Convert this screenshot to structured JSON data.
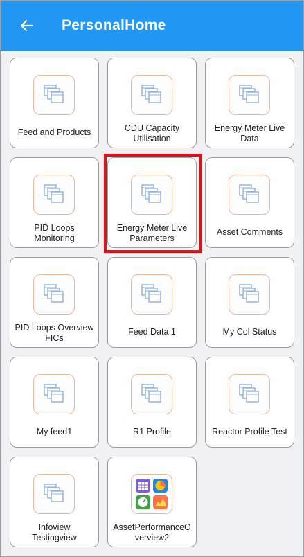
{
  "header": {
    "title": "PersonalHome",
    "back_icon": "arrow-left-icon"
  },
  "colors": {
    "appbar": "#2196f3",
    "highlight": "#e0101a",
    "icon_border": "#f2b89a"
  },
  "tiles": [
    {
      "label": "Feed and Products",
      "icon": "stacked-windows-icon"
    },
    {
      "label": "CDU Capacity\nUtilisation",
      "icon": "stacked-windows-icon"
    },
    {
      "label": "Energy Meter Live\nData",
      "icon": "stacked-windows-icon"
    },
    {
      "label": "PID Loops\nMonitoring",
      "icon": "stacked-windows-icon"
    },
    {
      "label": "Energy Meter Live\nParameters",
      "icon": "stacked-windows-icon",
      "highlighted": true
    },
    {
      "label": "Asset Comments",
      "icon": "stacked-windows-icon"
    },
    {
      "label": "PID Loops Overview\nFICs",
      "icon": "stacked-windows-icon"
    },
    {
      "label": "Feed Data 1",
      "icon": "stacked-windows-icon"
    },
    {
      "label": "My Col Status",
      "icon": "stacked-windows-icon"
    },
    {
      "label": "My feed1",
      "icon": "stacked-windows-icon"
    },
    {
      "label": "R1 Profile",
      "icon": "stacked-windows-icon"
    },
    {
      "label": "Reactor Profile Test",
      "icon": "stacked-windows-icon"
    },
    {
      "label": "Infoview\nTestingview",
      "icon": "stacked-windows-icon"
    },
    {
      "label": "AssetPerformanceO\nverview2",
      "icon": "dashboard-widgets-icon"
    }
  ]
}
